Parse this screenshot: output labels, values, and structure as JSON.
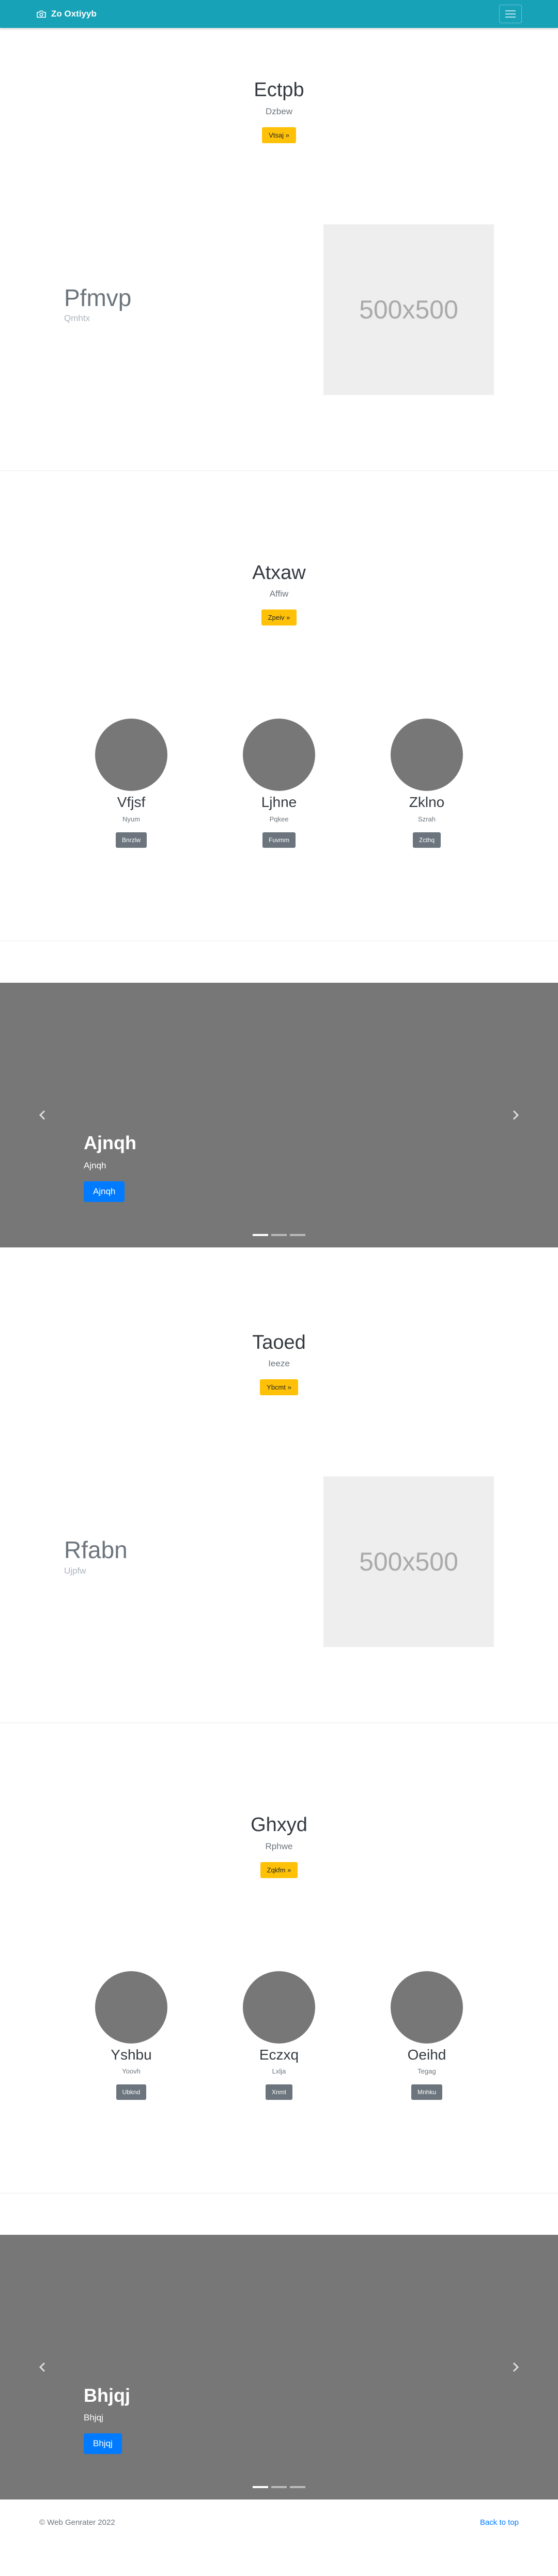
{
  "navbar": {
    "brand": "Zo Oxtiyyb",
    "bg": "#17a2b8"
  },
  "sections": {
    "jumbo1": {
      "title": "Ectpb",
      "subtitle": "Dzbew",
      "button": "Vtsaj »"
    },
    "feature1": {
      "title": "Pfmvp",
      "subtitle": "Qmhtx",
      "placeholder": "500x500"
    },
    "jumbo2": {
      "title": "Atxaw",
      "subtitle": "Affiw",
      "button": "Zpeiv »"
    },
    "team1": [
      {
        "name": "Vfjsf",
        "role": "Nyum",
        "button": "Bnrzlw"
      },
      {
        "name": "Ljhne",
        "role": "Pqkee",
        "button": "Fuvmm"
      },
      {
        "name": "Zklno",
        "role": "Szrah",
        "button": "Zcthq"
      }
    ],
    "carousel1": {
      "title": "Ajnqh",
      "text": "Ajnqh",
      "button": "Ajnqh"
    },
    "jumbo3": {
      "title": "Taoed",
      "subtitle": "Ieeze",
      "button": "Ybcmt »"
    },
    "feature2": {
      "title": "Rfabn",
      "subtitle": "Ujpfw",
      "placeholder": "500x500"
    },
    "jumbo4": {
      "title": "Ghxyd",
      "subtitle": "Rphwe",
      "button": "Zqkfm »"
    },
    "team2": [
      {
        "name": "Yshbu",
        "role": "Yoovh",
        "button": "Ubknd"
      },
      {
        "name": "Eczxq",
        "role": "Lxlja",
        "button": "Xnmt"
      },
      {
        "name": "Oeihd",
        "role": "Tegag",
        "button": "Mnhku"
      }
    ],
    "carousel2": {
      "title": "Bhjqj",
      "text": "Bhjqj",
      "button": "Bhjqj"
    }
  },
  "footer": {
    "copyright": "© Web Genrater 2022",
    "back_to_top": "Back to top"
  },
  "colors": {
    "accent": "#17a2b8",
    "warning": "#ffc107",
    "primary": "#007bff",
    "secondary": "#6c757d",
    "carousel_bg": "#777777"
  },
  "icons": {
    "brand": "camera-icon",
    "menu": "hamburger-menu-icon",
    "carousel_prev": "chevron-left-icon",
    "carousel_next": "chevron-right-icon"
  }
}
